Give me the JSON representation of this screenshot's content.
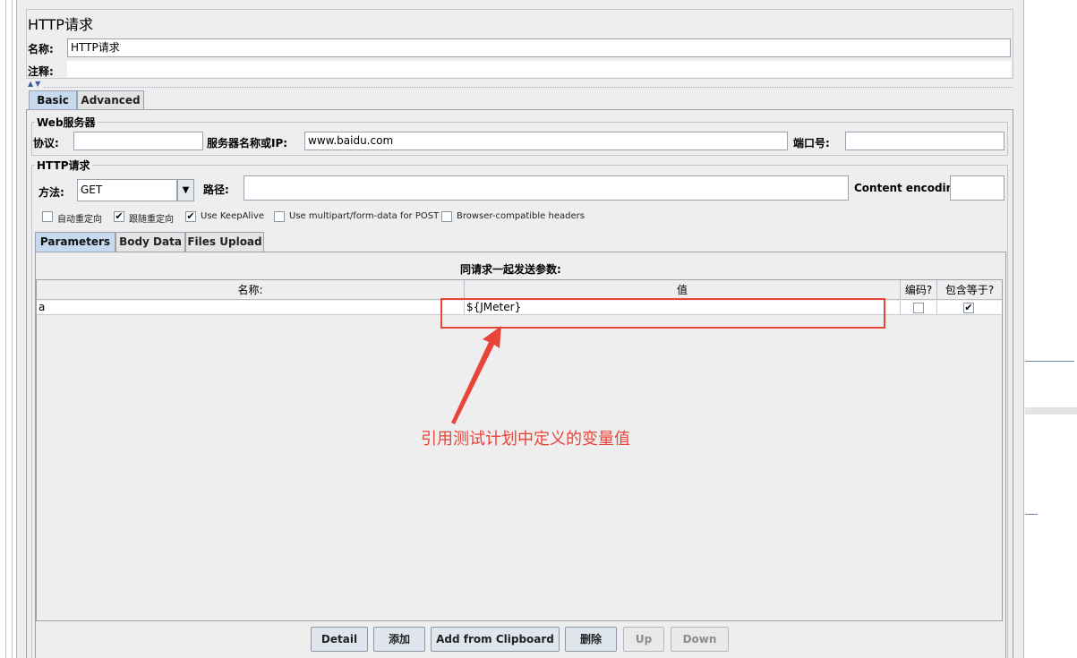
{
  "panel": {
    "title": "HTTP请求",
    "name_label": "名称:",
    "name_value": "HTTP请求",
    "comment_label": "注释:",
    "collapse_arrows": "▲▼"
  },
  "tabs": {
    "basic": "Basic",
    "advanced": "Advanced"
  },
  "web_server": {
    "title": "Web服务器",
    "protocol_label": "协议:",
    "protocol_value": "",
    "server_label": "服务器名称或IP:",
    "server_value": "www.baidu.com",
    "port_label": "端口号:",
    "port_value": ""
  },
  "http_request": {
    "title": "HTTP请求",
    "method_label": "方法:",
    "method_value": "GET",
    "path_label": "路径:",
    "path_value": "",
    "encoding_label": "Content encoding:",
    "encoding_value": ""
  },
  "options": [
    {
      "label": "自动重定向",
      "checked": false
    },
    {
      "label": "跟随重定向",
      "checked": true
    },
    {
      "label": "Use KeepAlive",
      "checked": true
    },
    {
      "label": "Use multipart/form-data for POST",
      "checked": false
    },
    {
      "label": "Browser-compatible headers",
      "checked": false
    }
  ],
  "inner_tabs": {
    "parameters": "Parameters",
    "body_data": "Body Data",
    "files_upload": "Files Upload"
  },
  "params_table": {
    "caption": "同请求一起发送参数:",
    "headers": [
      "名称:",
      "值",
      "编码?",
      "包含等于?"
    ],
    "rows": [
      {
        "name": "a",
        "value": "${JMeter}",
        "encode": false,
        "include_equals": true
      }
    ]
  },
  "buttons": {
    "detail": "Detail",
    "add": "添加",
    "add_clipboard": "Add from Clipboard",
    "delete": "删除",
    "up": "Up",
    "down": "Down"
  },
  "annotation": {
    "text": "引用测试计划中定义的变量值",
    "color": "#e8443a"
  },
  "check_mark": "✔",
  "dropdown_arrow": "▼"
}
